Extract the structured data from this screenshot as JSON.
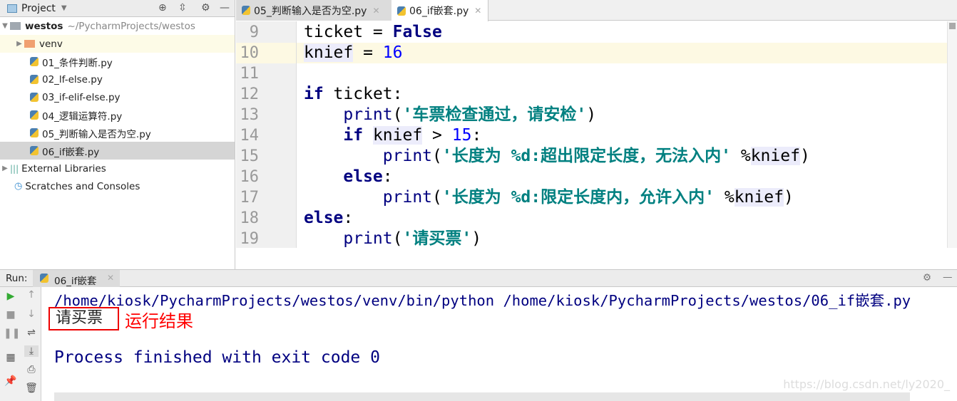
{
  "project": {
    "title": "Project",
    "root_name": "westos",
    "root_path": "~/PycharmProjects/westos",
    "items": [
      {
        "label": "venv",
        "type": "folder"
      },
      {
        "label": "01_条件判断.py"
      },
      {
        "label": "02_lf-else.py"
      },
      {
        "label": "03_if-elif-else.py"
      },
      {
        "label": "04_逻辑运算符.py"
      },
      {
        "label": "05_判断输入是否为空.py"
      },
      {
        "label": "06_if嵌套.py",
        "selected": true
      }
    ],
    "external": "External Libraries",
    "scratches": "Scratches and Consoles"
  },
  "tabs": [
    {
      "label": "05_判断输入是否为空.py"
    },
    {
      "label": "06_if嵌套.py",
      "active": true
    }
  ],
  "editor": {
    "current_line": "10",
    "lines": [
      {
        "n": "9",
        "t": [
          [
            "",
            "ticket = "
          ],
          [
            "kw",
            "False"
          ]
        ]
      },
      {
        "n": "10",
        "t": [
          [
            "var",
            "knief"
          ],
          [
            "",
            " = "
          ],
          [
            "num",
            "16"
          ]
        ]
      },
      {
        "n": "11",
        "t": []
      },
      {
        "n": "12",
        "t": [
          [
            "kw",
            "if"
          ],
          [
            "",
            " ticket:"
          ]
        ]
      },
      {
        "n": "13",
        "t": [
          [
            "",
            "    "
          ],
          [
            "bi",
            "print"
          ],
          [
            "",
            "("
          ],
          [
            "str",
            "'车票检查通过，请安检'"
          ],
          [
            "",
            ")"
          ]
        ]
      },
      {
        "n": "14",
        "t": [
          [
            "",
            "    "
          ],
          [
            "kw",
            "if"
          ],
          [
            "",
            " "
          ],
          [
            "var",
            "knief"
          ],
          [
            "",
            " > "
          ],
          [
            "num",
            "15"
          ],
          [
            "",
            ":"
          ]
        ]
      },
      {
        "n": "15",
        "t": [
          [
            "",
            "        "
          ],
          [
            "bi",
            "print"
          ],
          [
            "",
            "("
          ],
          [
            "str",
            "'长度为 %d:超出限定长度，无法入内'"
          ],
          [
            "",
            " %"
          ],
          [
            "var",
            "knief"
          ],
          [
            "",
            ")"
          ]
        ]
      },
      {
        "n": "16",
        "t": [
          [
            "",
            "    "
          ],
          [
            "kw",
            "else"
          ],
          [
            "",
            ":"
          ]
        ]
      },
      {
        "n": "17",
        "t": [
          [
            "",
            "        "
          ],
          [
            "bi",
            "print"
          ],
          [
            "",
            "("
          ],
          [
            "str",
            "'长度为 %d:限定长度内，允许入内'"
          ],
          [
            "",
            " %"
          ],
          [
            "var",
            "knief"
          ],
          [
            "",
            ")"
          ]
        ]
      },
      {
        "n": "18",
        "t": [
          [
            "kw",
            "else"
          ],
          [
            "",
            ":"
          ]
        ]
      },
      {
        "n": "19",
        "t": [
          [
            "",
            "    "
          ],
          [
            "bi",
            "print"
          ],
          [
            "",
            "("
          ],
          [
            "str",
            "'请买票'"
          ],
          [
            "",
            ")"
          ]
        ]
      }
    ]
  },
  "run": {
    "label": "Run:",
    "tab": "06_if嵌套",
    "command": "/home/kiosk/PycharmProjects/westos/venv/bin/python /home/kiosk/PycharmProjects/westos/06_if嵌套.py",
    "output": "请买票",
    "annotation": "运行结果",
    "exit": "Process finished with exit code 0"
  },
  "watermark": "https://blog.csdn.net/ly2020_",
  "colors": {
    "keyword": "#000080",
    "number": "#0000ff",
    "string": "#008080",
    "annotation": "#ff0000"
  }
}
